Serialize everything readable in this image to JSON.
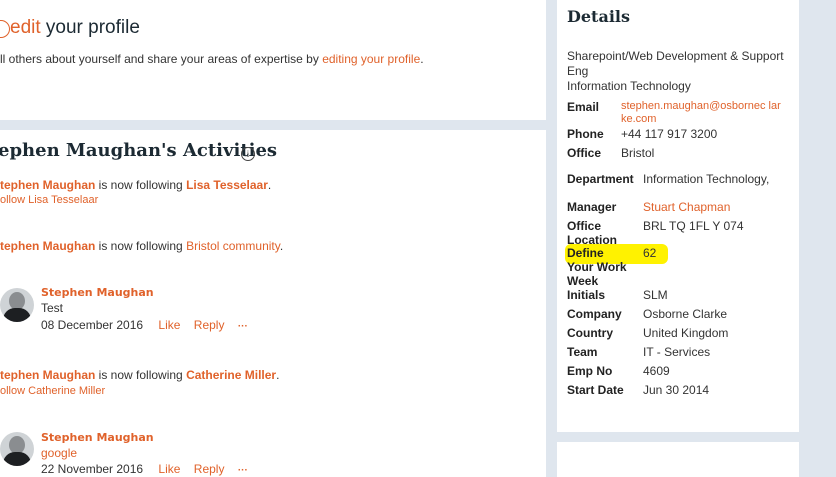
{
  "profile_prompt": {
    "heading_icon": "chevron-right-circle-icon",
    "heading_link": "edit",
    "heading_rest": " your profile",
    "desc_prefix": "ll others about yourself and share your areas of expertise by ",
    "desc_link": "editing your profile",
    "desc_suffix": "."
  },
  "activities": {
    "title": "ephen Maughan's Activities",
    "info_icon": "info-icon",
    "items": [
      {
        "actor": "tephen Maughan",
        "verb": " is now following ",
        "target": "Lisa Tesselaar",
        "target_bold": true,
        "suffix": ".",
        "follow": "ollow Lisa Tesselaar"
      },
      {
        "actor": "tephen Maughan",
        "verb": " is now following ",
        "target": "Bristol community",
        "target_bold": false,
        "suffix": "."
      },
      {
        "name": "Stephen Maughan",
        "message": "Test",
        "date": "08 December 2016",
        "like": "Like",
        "reply": "Reply",
        "more": "···"
      },
      {
        "actor": "tephen Maughan",
        "verb": " is now following ",
        "target": "Catherine Miller",
        "target_bold": true,
        "suffix": ".",
        "follow": "ollow Catherine Miller"
      },
      {
        "name": "Stephen Maughan",
        "message": "google",
        "date": "22 November 2016",
        "like": "Like",
        "reply": "Reply",
        "more": "···"
      }
    ]
  },
  "details": {
    "title": "Details",
    "role": "Sharepoint/Web Development & Support Eng",
    "dept_line": "Information Technology",
    "contact": [
      {
        "label": "Email",
        "value": "stephen.maughan@osbornec larke.com",
        "link": true
      },
      {
        "label": "Phone",
        "value": "+44 117 917 3200"
      },
      {
        "label": "Office",
        "value": "Bristol"
      }
    ],
    "fields": {
      "department_label": "Department",
      "department_value": "Information Technology,",
      "manager_label": "Manager",
      "manager_value": "Stuart Chapman",
      "office_location_label": "Office Location",
      "office_location_value": "BRL TQ 1FL Y 074",
      "define_label": "Define",
      "define_value": "62",
      "work_week_label": "Your Work Week",
      "initials_label": "Initials",
      "initials_value": "SLM",
      "company_label": "Company",
      "company_value": "Osborne Clarke",
      "country_label": "Country",
      "country_value": "United Kingdom",
      "team_label": "Team",
      "team_value": "IT - Services",
      "emp_no_label": "Emp No",
      "emp_no_value": "4609",
      "start_date_label": "Start Date",
      "start_date_value": "Jun 30 2014"
    },
    "highlight_color": "#fff200"
  }
}
